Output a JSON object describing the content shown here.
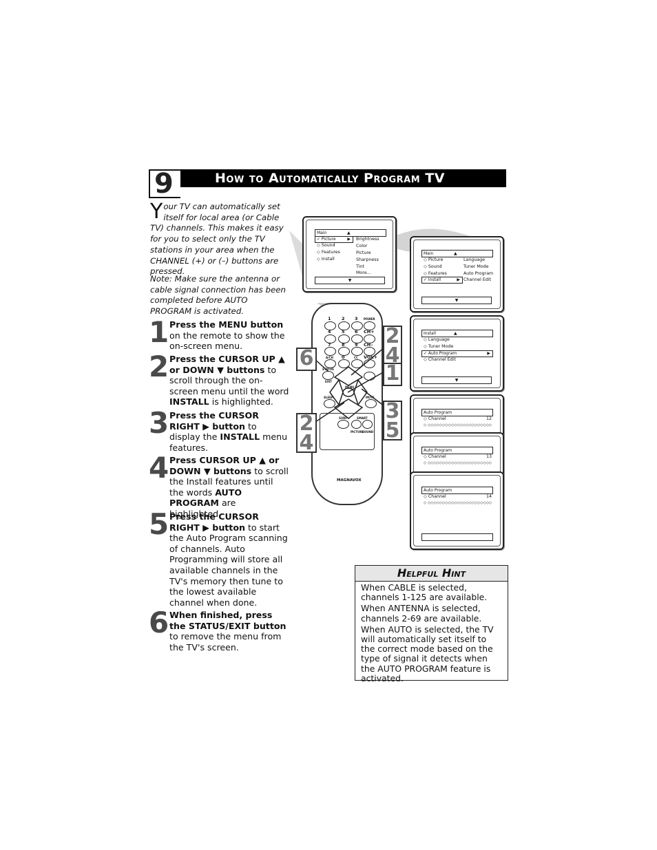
{
  "section": {
    "number": "9",
    "title": "How to Automatically Program TV"
  },
  "intro": {
    "drop_cap": "Y",
    "text": "our TV can automatically set itself for local area (or Cable TV) channels. This makes it easy for you to select only the TV stations in your area when the CHANNEL (+) or (–) buttons are pressed.",
    "note": "Note: Make sure the antenna or cable signal connection has been completed before AUTO PROGRAM is activated."
  },
  "steps": [
    {
      "num": "1",
      "bold": "Press the MENU button",
      "rest": " on the remote to show the on-screen menu."
    },
    {
      "num": "2",
      "bold": "Press the CURSOR UP ▲ or DOWN ▼ buttons",
      "rest": " to scroll through the on-screen menu until the word ",
      "bold2": "INSTALL",
      "rest2": " is highlighted."
    },
    {
      "num": "3",
      "bold": "Press the CURSOR RIGHT ▶ button",
      "rest": " to display the ",
      "bold2": "INSTALL",
      "rest2": " menu features."
    },
    {
      "num": "4",
      "bold": "Press CURSOR UP ▲ or DOWN ▼ buttons",
      "rest": " to scroll the Install features until the words ",
      "bold2": "AUTO PROGRAM",
      "rest2": " are highlighted."
    },
    {
      "num": "5",
      "bold": "Press the CURSOR RIGHT ▶ button",
      "rest": " to start the Auto Program scanning of channels. Auto Programming will store all available channels in the TV's memory then tune to the lowest available channel when done."
    },
    {
      "num": "6",
      "bold": "When finished, press the STATUS/EXIT button",
      "rest": " to remove the menu from the TV's screen."
    }
  ],
  "screens": {
    "main_picture": {
      "title": "Main",
      "items": [
        "✓ Picture",
        "◇ Sound",
        "◇ Features",
        "◇ Install"
      ],
      "submenu": [
        "Brightness",
        "Color",
        "Picture",
        "Sharpness",
        "Tint",
        "More..."
      ]
    },
    "main_install": {
      "title": "Main",
      "items": [
        "◇ Picture",
        "◇ Sound",
        "◇ Features",
        "✓ Install"
      ],
      "submenu": [
        "Language",
        "Tuner Mode",
        "Auto Program",
        "Channel Edit"
      ]
    },
    "install": {
      "title": "Install",
      "items": [
        "◇ Language",
        "◇ Tuner Mode",
        "✓ Auto Program",
        "◇ Channel Edit"
      ]
    },
    "auto_program": [
      {
        "title": "Auto Program",
        "label": "◇ Channel",
        "channel": "12",
        "progress": "◇ ◇◇◇◇◇◇◇◇◇◇◇◇◇◇◇◇◇◇◇◇◇◇"
      },
      {
        "title": "Auto Program",
        "label": "◇ Channel",
        "channel": "13",
        "progress": "◇ ◇◇◇◇◇◇◇◇◇◇◇◇◇◇◇◇◇◇◇◇◇◇"
      },
      {
        "title": "Auto Program",
        "label": "◇ Channel",
        "channel": "14",
        "progress": "◇ ◇◇◇◇◇◇◇◇◇◇◇◇◇◇◇◇◇◇◇◇◇◇"
      }
    ],
    "up_arrow": "▲",
    "down_arrow": "▼",
    "right_arrow": "▶"
  },
  "remote": {
    "keys": [
      "1",
      "2",
      "3",
      "POWER",
      "4",
      "5",
      "6",
      "CH+",
      "7",
      "8",
      "9",
      "CH–",
      "A/CH",
      "0",
      "CC",
      "VOL+"
    ],
    "status": "STATUS",
    "exit": "EXIT",
    "menu": "MENU",
    "sleep": "SLEEP",
    "mute": "MUTE",
    "surf": "SURF",
    "smart": "SMART",
    "picture": "PICTURE",
    "sound": "SOUND",
    "brand": "MAGNAVOX",
    "callouts": {
      "a": "6",
      "b": "2\n4",
      "c": "1",
      "d": "2\n4",
      "e": "3\n5"
    }
  },
  "hint": {
    "title": "Helpful Hint",
    "paragraphs": [
      "When CABLE is selected, channels 1-125 are available.",
      "When ANTENNA is selected, channels 2-69 are available.",
      "When AUTO is selected, the TV will automatically set itself to the correct mode based on the type of signal it detects when the AUTO PROGRAM feature is activated."
    ]
  }
}
